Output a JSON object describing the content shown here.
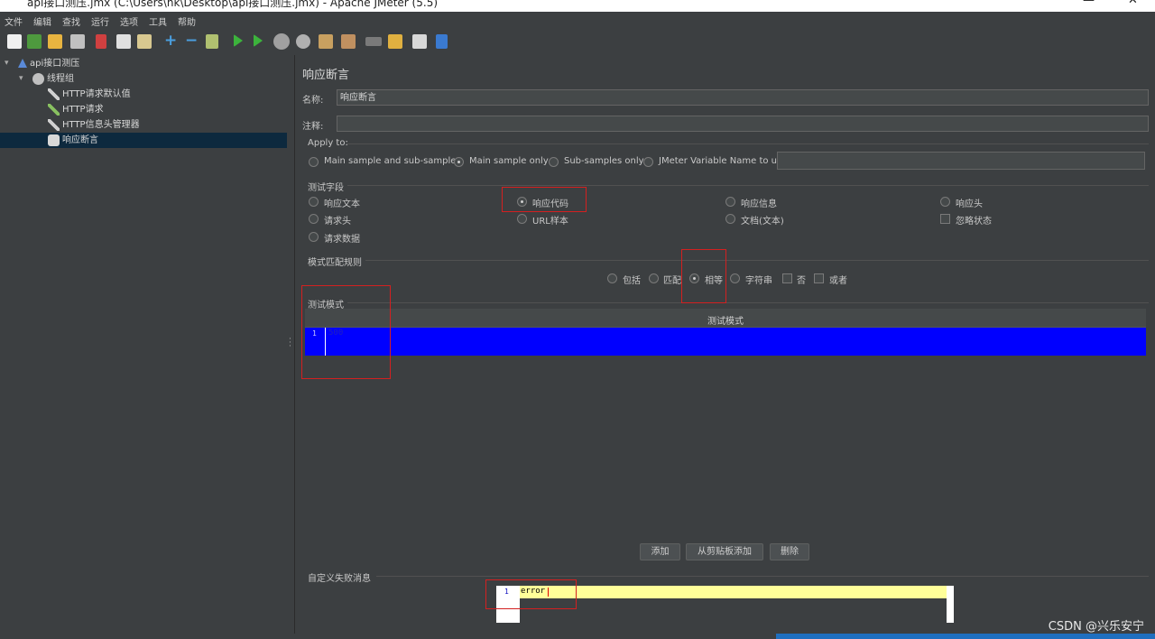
{
  "window": {
    "title": "api接口测压.jmx (C:\\Users\\hk\\Desktop\\api接口测压.jmx) - Apache JMeter (5.5)",
    "min_glyph": "—",
    "close_glyph": "✕"
  },
  "menu": [
    "文件",
    "编辑",
    "查找",
    "运行",
    "选项",
    "工具",
    "帮助"
  ],
  "tree": {
    "root": "api接口测压",
    "thread_group": "线程组",
    "children": [
      "HTTP请求默认值",
      "HTTP请求",
      "HTTP信息头管理器",
      "响应断言"
    ]
  },
  "panel": {
    "heading": "响应断言",
    "name_label": "名称:",
    "name_value": "响应断言",
    "comment_label": "注释:",
    "comment_value": "",
    "apply_to": {
      "label": "Apply to:",
      "options": [
        "Main sample and sub-samples",
        "Main sample only",
        "Sub-samples only",
        "JMeter Variable Name to use"
      ],
      "selected": "Main sample only",
      "variable_value": ""
    },
    "field_to_test": {
      "label": "测试字段",
      "options": [
        "响应文本",
        "响应代码",
        "响应信息",
        "响应头",
        "请求头",
        "URL样本",
        "文档(文本)",
        "忽略状态",
        "请求数据"
      ],
      "selected": "响应代码"
    },
    "pattern_rules": {
      "label": "模式匹配规则",
      "options": [
        "包括",
        "匹配",
        "相等",
        "字符串",
        "否",
        "或者"
      ],
      "selected": "相等"
    },
    "patterns": {
      "label": "测试模式",
      "column_header": "测试模式",
      "rows": [
        {
          "line": "1",
          "value": "500"
        }
      ]
    },
    "buttons": {
      "add": "添加",
      "add_clipboard": "从剪贴板添加",
      "delete": "删除"
    },
    "custom_failure": {
      "label": "自定义失败消息",
      "line": "1",
      "value": "error"
    }
  },
  "watermark": "CSDN @兴乐安宁",
  "colors": {
    "accent_blue": "#0000ff",
    "highlight_yellow": "#ffff99",
    "annotation_red": "#d32020"
  }
}
